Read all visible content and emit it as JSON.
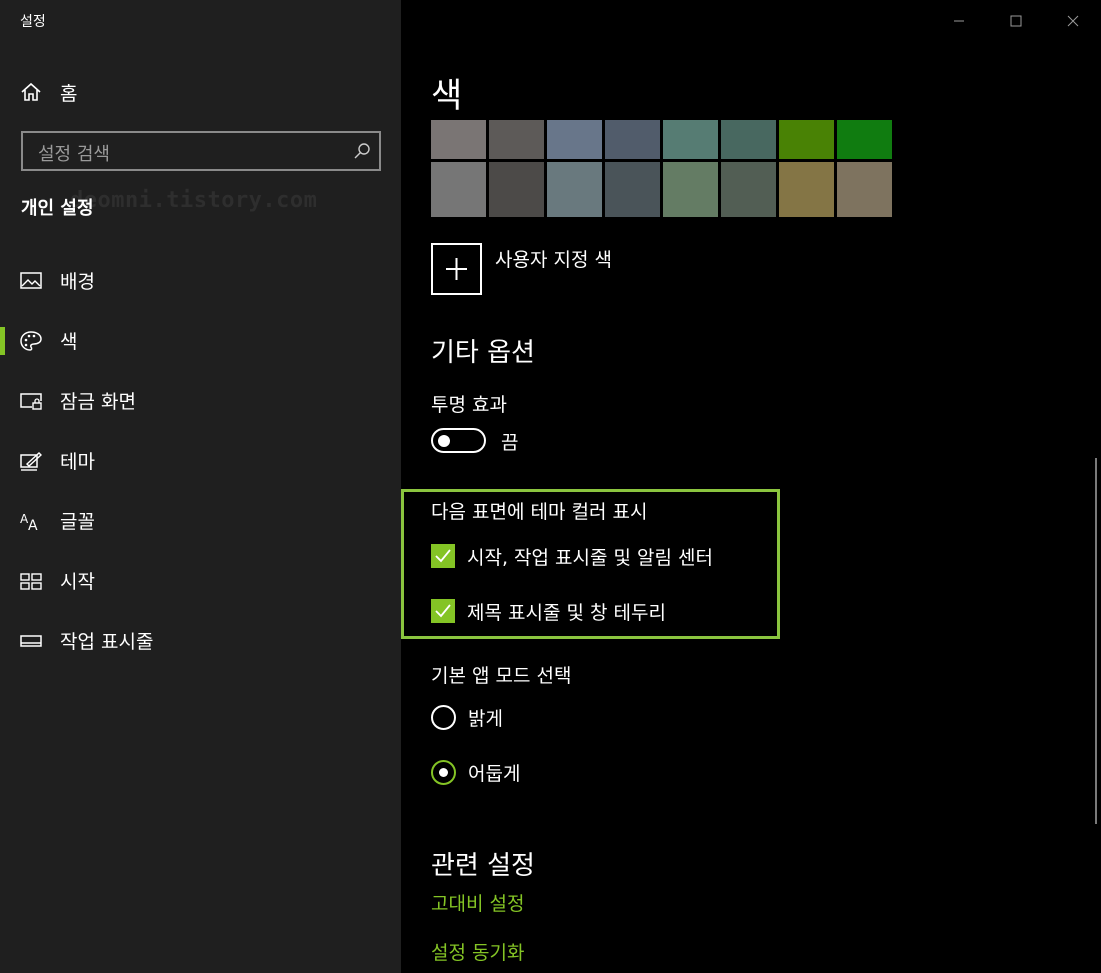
{
  "window": {
    "title": "설정"
  },
  "sidebar": {
    "home_label": "홈",
    "search_placeholder": "설정 검색",
    "section_title": "개인 설정",
    "watermark": "deomni.tistory.com",
    "items": [
      {
        "label": "배경",
        "icon": "picture-icon"
      },
      {
        "label": "색",
        "icon": "palette-icon",
        "selected": true
      },
      {
        "label": "잠금 화면",
        "icon": "lock-screen-icon"
      },
      {
        "label": "테마",
        "icon": "theme-icon"
      },
      {
        "label": "글꼴",
        "icon": "font-icon"
      },
      {
        "label": "시작",
        "icon": "start-icon"
      },
      {
        "label": "작업 표시줄",
        "icon": "taskbar-icon"
      }
    ]
  },
  "main": {
    "color_heading": "색",
    "swatch_colors": [
      [
        "#7a7574",
        "#5d5a58",
        "#68768a",
        "#515c6b",
        "#567c73",
        "#486860",
        "#498205",
        "#107c10"
      ],
      [
        "#767676",
        "#4c4a48",
        "#69797e",
        "#4a5459",
        "#647c64",
        "#525e54",
        "#847545",
        "#7e735f"
      ]
    ],
    "custom_color_label": "사용자 지정 색",
    "other_options_heading": "기타 옵션",
    "transparency_label": "투명 효과",
    "transparency_state": "끔",
    "surfaces_label": "다음 표면에 테마 컬러 표시",
    "checkboxes": [
      {
        "label": "시작, 작업 표시줄 및 알림 센터",
        "checked": true
      },
      {
        "label": "제목 표시줄 및 창 테두리",
        "checked": true
      }
    ],
    "app_mode_label": "기본 앱 모드 선택",
    "app_modes": [
      {
        "label": "밝게",
        "checked": false
      },
      {
        "label": "어둡게",
        "checked": true
      }
    ],
    "related_heading": "관련 설정",
    "links": [
      "고대비 설정",
      "설정 동기화"
    ]
  },
  "colors": {
    "accent": "#84c425",
    "highlight_border": "#8bc53f",
    "sidebar_bg": "#1f1f1f"
  }
}
